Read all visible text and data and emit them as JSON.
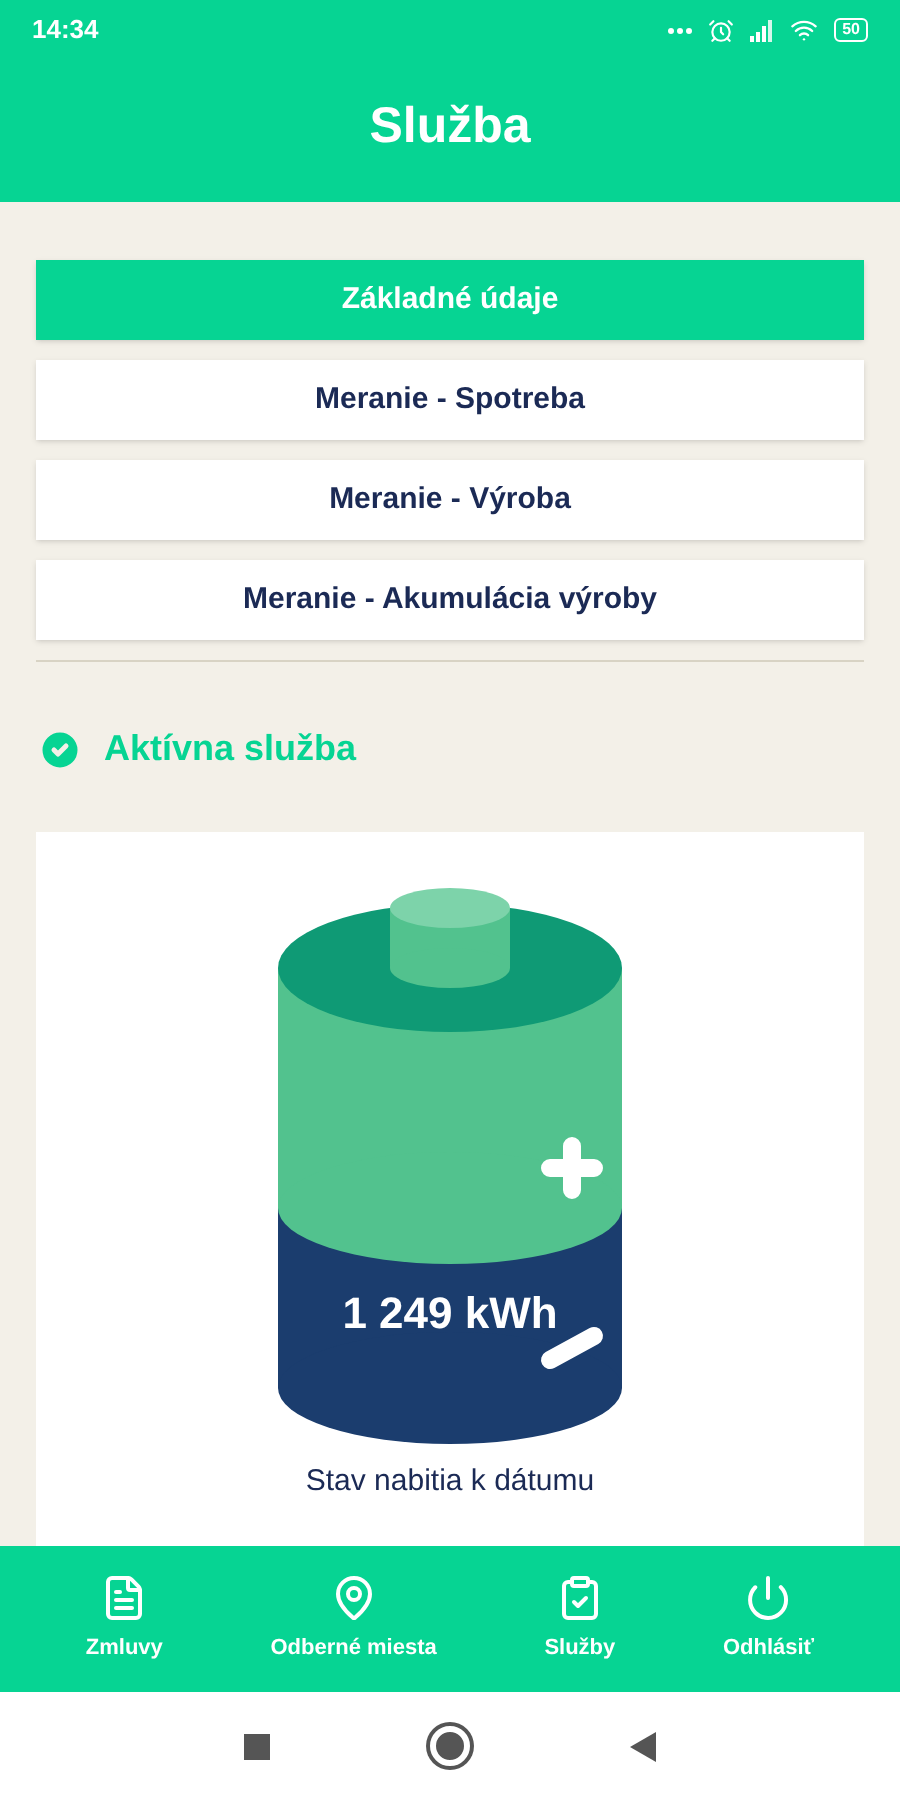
{
  "status_bar": {
    "time": "14:34",
    "battery": "50"
  },
  "header": {
    "title": "Služba"
  },
  "tabs": [
    {
      "label": "Základné údaje",
      "selected": true
    },
    {
      "label": "Meranie - Spotreba",
      "selected": false
    },
    {
      "label": "Meranie - Výroba",
      "selected": false
    },
    {
      "label": "Meranie - Akumulácia výroby",
      "selected": false
    }
  ],
  "service_status": {
    "label": "Aktívna služba",
    "active": true
  },
  "battery_card": {
    "value": "1 249 kWh",
    "caption": "Stav nabitia k dátumu"
  },
  "bottom_nav": [
    {
      "label": "Zmluvy",
      "kind": "document"
    },
    {
      "label": "Odberné miesta",
      "kind": "pin"
    },
    {
      "label": "Služby",
      "kind": "clipboard"
    },
    {
      "label": "Odhlásiť",
      "kind": "power"
    }
  ]
}
